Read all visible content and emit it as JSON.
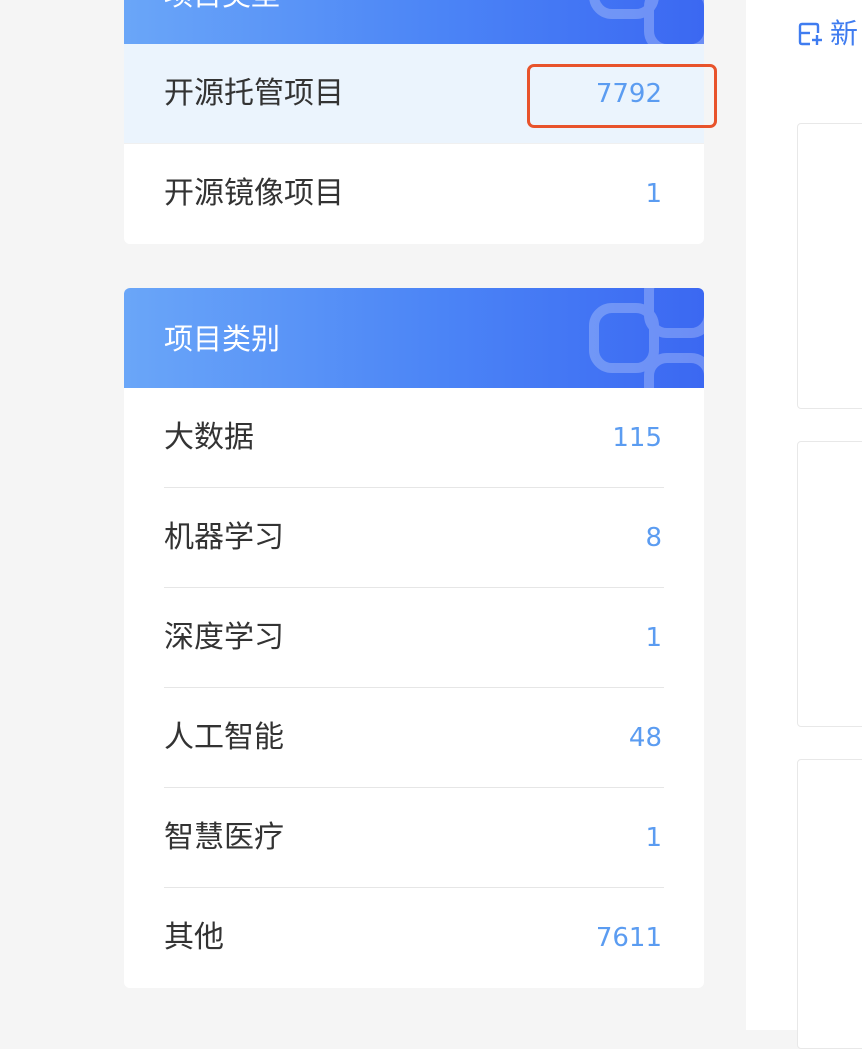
{
  "project_type_panel": {
    "title": "项目类型",
    "items": [
      {
        "label": "开源托管项目",
        "count": "7792",
        "selected": true
      },
      {
        "label": "开源镜像项目",
        "count": "1",
        "selected": false
      }
    ]
  },
  "project_category_panel": {
    "title": "项目类别",
    "items": [
      {
        "label": "大数据",
        "count": "115"
      },
      {
        "label": "机器学习",
        "count": "8"
      },
      {
        "label": "深度学习",
        "count": "1"
      },
      {
        "label": "人工智能",
        "count": "48"
      },
      {
        "label": "智慧医疗",
        "count": "1"
      },
      {
        "label": "其他",
        "count": "7611"
      }
    ]
  },
  "toolbar": {
    "new_label": "新"
  },
  "colors": {
    "accent": "#3f7cf0",
    "count": "#5b9cf1",
    "header_start": "#6aa6f8",
    "header_end": "#3b68f2",
    "selected_row": "#ebf4fd",
    "highlight": "#e8532b"
  }
}
